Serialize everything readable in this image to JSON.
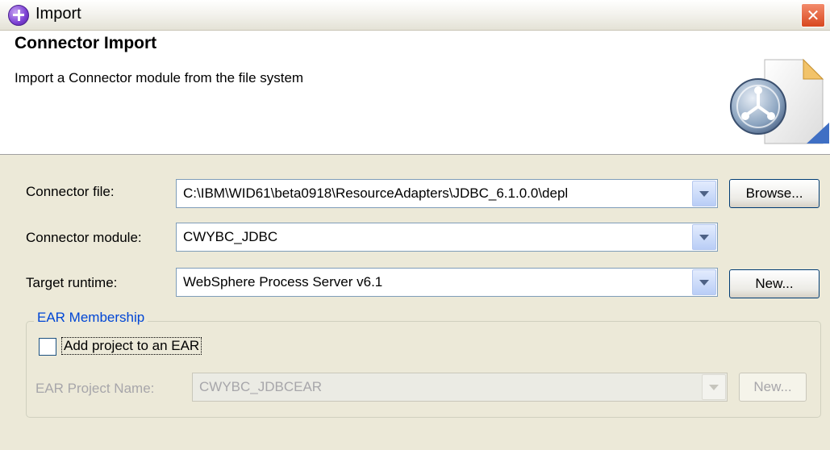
{
  "window": {
    "title": "Import",
    "close_glyph": "✕"
  },
  "banner": {
    "title": "Connector Import",
    "description": "Import a Connector module from the file system",
    "graphic_icon": "connector-wizard-icon"
  },
  "form": {
    "connector_file": {
      "label": "Connector file:",
      "value": "C:\\IBM\\WID61\\beta0918\\ResourceAdapters\\JDBC_6.1.0.0\\depl",
      "button": "Browse..."
    },
    "connector_module": {
      "label": "Connector module:",
      "value": "CWYBC_JDBC"
    },
    "target_runtime": {
      "label": "Target runtime:",
      "value": "WebSphere Process Server v6.1",
      "button": "New..."
    }
  },
  "ear": {
    "legend": "EAR Membership",
    "checkbox_label": "Add project to an EAR",
    "checked": false,
    "project_label": "EAR Project Name:",
    "project_value": "CWYBC_JDBCEAR",
    "button": "New..."
  },
  "colors": {
    "legend": "#0046d5",
    "close": "#d8481f",
    "dialog_bg": "#ece9d8"
  }
}
